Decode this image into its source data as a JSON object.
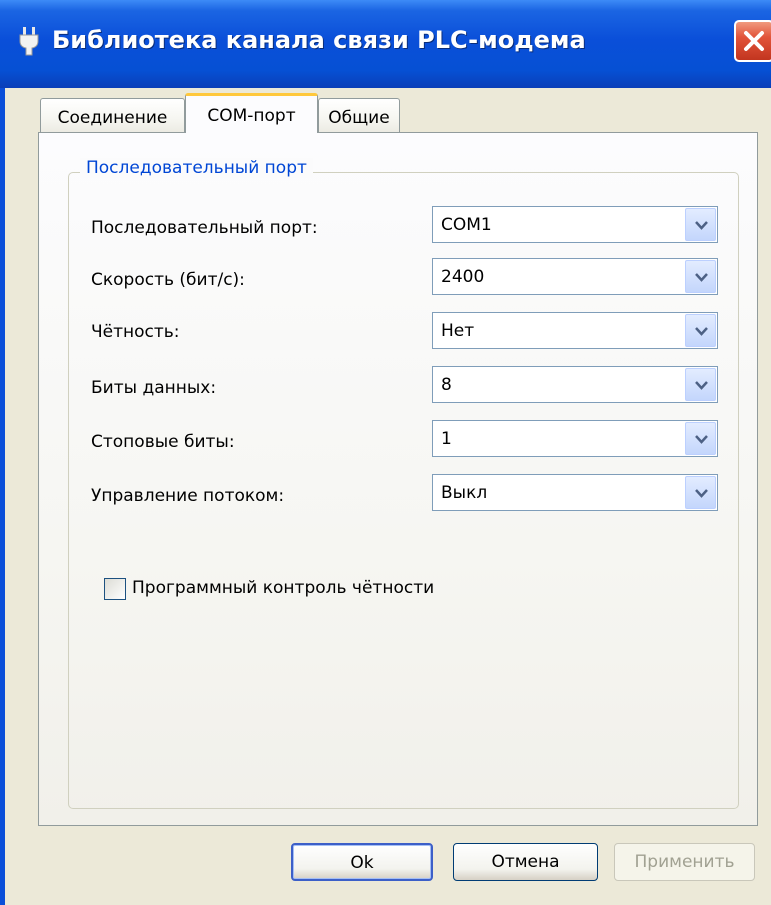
{
  "window": {
    "title": "Библиотека канала связи PLC-модема"
  },
  "tabs": [
    {
      "label": "Соединение",
      "active": false
    },
    {
      "label": "COM-порт",
      "active": true
    },
    {
      "label": "Общие",
      "active": false
    }
  ],
  "group": {
    "title": "Последовательный порт",
    "fields": [
      {
        "label": "Последовательный порт:",
        "value": "COM1"
      },
      {
        "label": "Скорость (бит/с):",
        "value": "2400"
      },
      {
        "label": "Чётность:",
        "value": "Нет"
      },
      {
        "label": "Биты данных:",
        "value": "8"
      },
      {
        "label": "Стоповые биты:",
        "value": "1"
      },
      {
        "label": "Управление потоком:",
        "value": "Выкл"
      }
    ],
    "checkbox": {
      "label": "Программный контроль чётности",
      "checked": false
    }
  },
  "buttons": {
    "ok": "Ok",
    "cancel": "Отмена",
    "apply": "Применить"
  },
  "colors": {
    "title_bar": "#0a4fd9",
    "group_title": "#0046d5",
    "tab_highlight": "#ffc83c"
  }
}
